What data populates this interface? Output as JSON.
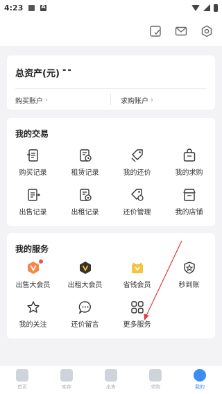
{
  "status_bar": {
    "time": "4:23"
  },
  "assets": {
    "title": "总资产(元)",
    "value": "--",
    "buy_account": "购买账户",
    "sell_account": "求购账户"
  },
  "trade": {
    "title": "我的交易",
    "items": [
      {
        "label": "购买记录",
        "icon": "buy-record-icon"
      },
      {
        "label": "租赁记录",
        "icon": "rent-record-icon"
      },
      {
        "label": "我的还价",
        "icon": "my-bargain-icon"
      },
      {
        "label": "我的求购",
        "icon": "my-request-icon"
      },
      {
        "label": "出售记录",
        "icon": "sell-record-icon"
      },
      {
        "label": "出租记录",
        "icon": "lease-record-icon"
      },
      {
        "label": "还价管理",
        "icon": "bargain-manage-icon"
      },
      {
        "label": "我的店铺",
        "icon": "store-icon"
      }
    ]
  },
  "service": {
    "title": "我的服务",
    "items": [
      {
        "label": "出售大会员",
        "icon": "sell-vip-icon"
      },
      {
        "label": "出租大会员",
        "icon": "rent-vip-icon"
      },
      {
        "label": "省钱会员",
        "icon": "save-money-vip-icon"
      },
      {
        "label": "秒到账",
        "icon": "instant-credit-icon"
      },
      {
        "label": "我的关注",
        "icon": "star-icon"
      },
      {
        "label": "还价留言",
        "icon": "message-icon"
      },
      {
        "label": "更多服务",
        "icon": "more-services-icon"
      }
    ]
  },
  "tabbar": {
    "tabs": [
      {
        "label": "首页",
        "active": false
      },
      {
        "label": "库存",
        "active": false
      },
      {
        "label": "出售",
        "active": false
      },
      {
        "label": "求购",
        "active": false
      },
      {
        "label": "我的",
        "active": true
      }
    ]
  },
  "colors": {
    "accent": "#3b8cf5",
    "arrow": "#e23b3b",
    "badge": "#f0524a",
    "vip_orange": "#f2894a",
    "vip_dark": "#3a3226",
    "vip_gold": "#f4c542"
  }
}
